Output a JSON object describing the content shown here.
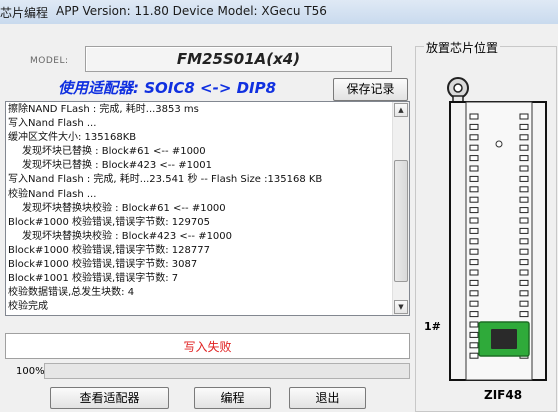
{
  "titlebar": {
    "app_name": "芯片编程",
    "info": "APP Version: 11.80 Device Model: XGecu T56"
  },
  "model": {
    "label": "MODEL:",
    "value": "FM25S01A(x4)"
  },
  "adapter": {
    "text": "使用适配器: SOIC8 <-> DIP8"
  },
  "buttons": {
    "save_log": "保存记录",
    "view_adapter": "查看适配器",
    "program": "编程",
    "exit": "退出"
  },
  "log": {
    "lines": [
      {
        "text": "擦除NAND FLash : 完成, 耗时...3853 ms",
        "indent": false
      },
      {
        "text": "写入Nand Flash ...",
        "indent": false
      },
      {
        "text": "缓冲区文件大小: 135168KB",
        "indent": false
      },
      {
        "text": "发现坏块已替换 : Block#61 <-- #1000",
        "indent": true
      },
      {
        "text": "发现坏块已替换 : Block#423 <-- #1001",
        "indent": true
      },
      {
        "text": "写入Nand Flash : 完成, 耗时...23.541 秒 --  Flash Size :135168 KB",
        "indent": false
      },
      {
        "text": "校验Nand Flash ...",
        "indent": false
      },
      {
        "text": "发现坏块替换块校验 : Block#61 <-- #1000",
        "indent": true
      },
      {
        "text": "Block#1000 校验错误,错误字节数: 129705",
        "indent": false
      },
      {
        "text": "发现坏块替换块校验 : Block#423 <-- #1000",
        "indent": true
      },
      {
        "text": "Block#1000 校验错误,错误字节数: 128777",
        "indent": false
      },
      {
        "text": "Block#1000 校验错误,错误字节数: 3087",
        "indent": false
      },
      {
        "text": "Block#1001 校验错误,错误字节数: 7",
        "indent": false
      },
      {
        "text": "校验数据错误,总发生块数: 4",
        "indent": false
      },
      {
        "text": "校验完成",
        "indent": false
      }
    ],
    "scroll_up_icon": "triangle-up",
    "scroll_down_icon": "triangle-down"
  },
  "status": {
    "text": "写入失败",
    "color": "#e02020"
  },
  "progress": {
    "label": "100%",
    "value": 1.0
  },
  "chip_panel": {
    "title": "放置芯片位置",
    "pin1_label": "1#",
    "socket_label": "ZIF48",
    "pcb_color": "#2faa3a",
    "chip_color": "#2a2a2a"
  }
}
